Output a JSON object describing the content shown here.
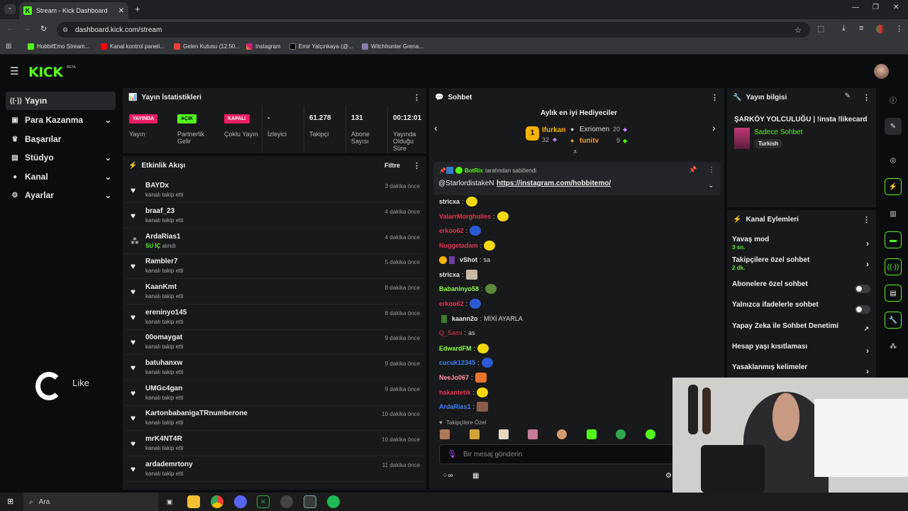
{
  "browser": {
    "tab_title": "Stream - Kick Dashboard",
    "url": "dashboard.kick.com/stream",
    "bookmarks": [
      "HobbitEmo Stream...",
      "Kanal kontrol paneli...",
      "Gelen Kutusu (12.50...",
      "Instagram",
      "Emir Yalçınkaya (@...",
      "Witchhunter Grena..."
    ]
  },
  "app": {
    "logo": "KICK",
    "beta": "BETA"
  },
  "sidebar": {
    "items": [
      {
        "label": "Yayın",
        "icon": "broadcast-icon"
      },
      {
        "label": "Para Kazanma",
        "icon": "money-icon"
      },
      {
        "label": "Başarılar",
        "icon": "trophy-icon"
      },
      {
        "label": "Stüdyo",
        "icon": "studio-icon"
      },
      {
        "label": "Kanal",
        "icon": "user-icon"
      },
      {
        "label": "Ayarlar",
        "icon": "gear-icon"
      }
    ]
  },
  "overlay": {
    "like": "Like"
  },
  "stats": {
    "title": "Yayın İstatistikleri",
    "items": [
      {
        "badge": "YAYINDA",
        "label": "Yayın"
      },
      {
        "badge": "AÇIK",
        "label": "Partnerlik Gelir"
      },
      {
        "badge": "KAPALI",
        "label": "Çoklu Yayın"
      },
      {
        "value": "-",
        "label": "İzleyici"
      },
      {
        "value": "61.278",
        "label": "Takipçi"
      },
      {
        "value": "131",
        "label": "Abone Sayısı"
      },
      {
        "value": "00:12:01",
        "label": "Yayında Olduğu Süre"
      }
    ]
  },
  "activity": {
    "title": "Etkinlik Akışı",
    "filter": "Filtre",
    "items": [
      {
        "name": "BAYDx",
        "sub": "kanalı takip etti",
        "time": "3 dakika önce"
      },
      {
        "name": "braaf_23",
        "sub": "kanalı takip etti",
        "time": "4 dakika önce"
      },
      {
        "name": "ArdaRias1",
        "sub_hl": "SU İÇ",
        "sub": "alındı",
        "time": "4 dakika önce"
      },
      {
        "name": "Rambler7",
        "sub": "kanalı takip etti",
        "time": "5 dakika önce"
      },
      {
        "name": "KaanKmt",
        "sub": "kanalı takip etti",
        "time": "8 dakika önce"
      },
      {
        "name": "ereninyo145",
        "sub": "kanalı takip etti",
        "time": "8 dakika önce"
      },
      {
        "name": "00omaygat",
        "sub": "kanalı takip etti",
        "time": "9 dakika önce"
      },
      {
        "name": "batuhanxw",
        "sub": "kanalı takip etti",
        "time": "9 dakika önce"
      },
      {
        "name": "UMGc4gan",
        "sub": "kanalı takip etti",
        "time": "9 dakika önce"
      },
      {
        "name": "KartonbabanigaTRnumberone",
        "sub": "kanalı takip etti",
        "time": "10 dakika önce"
      },
      {
        "name": "mrK4NT4R",
        "sub": "kanalı takip etti",
        "time": "10 dakika önce"
      },
      {
        "name": "ardademrtony",
        "sub": "kanalı takip etti",
        "time": "11 dakika önce"
      }
    ]
  },
  "chat": {
    "title": "Sohbet",
    "gifters_title": "Aylık en iyi Hediyeciler",
    "gifters": [
      {
        "name": "Ifurkan",
        "count": "32"
      },
      {
        "name": "Exriomen",
        "count": "20"
      },
      {
        "name": "tunitv",
        "count": "9"
      }
    ],
    "pinned_by": "BotRix",
    "pinned_suffix": "tarafından sabitlendi",
    "pinned_user": "@StarlordistakeN",
    "pinned_link": "https://instagram.com/hobbitemo/",
    "messages": [
      {
        "user": "stricxa",
        "color": "#e8e8e8",
        "text": ""
      },
      {
        "user": "ValarrMorghulles",
        "color": "#e0364f",
        "text": ""
      },
      {
        "user": "erkoo62",
        "color": "#e0364f",
        "text": ""
      },
      {
        "user": "Nuggetadam",
        "color": "#e0364f",
        "text": ""
      },
      {
        "user": "vShot",
        "color": "#e8e8e8",
        "text": "sa"
      },
      {
        "user": "stricxa",
        "color": "#e8e8e8",
        "text": ""
      },
      {
        "user": "Babaninyo58",
        "color": "#8bff4e",
        "text": ""
      },
      {
        "user": "erkoo62",
        "color": "#e0364f",
        "text": ""
      },
      {
        "user": "kaann2o",
        "color": "#e8e8e8",
        "text": "MİXİ AYARLA"
      },
      {
        "user": "Q_Sami",
        "color": "#e0364f",
        "text": "as"
      },
      {
        "user": "EdwardFM",
        "color": "#8bff4e",
        "text": ""
      },
      {
        "user": "cucuk12345",
        "color": "#3b82f6",
        "text": ""
      },
      {
        "user": "NeeJo067",
        "color": "#ff8fa3",
        "text": ""
      },
      {
        "user": "hakantetik",
        "color": "#e0364f",
        "text": ""
      },
      {
        "user": "ArdaRias1",
        "color": "#3b82f6",
        "text": ""
      }
    ],
    "follower_only": "Takipçilere Özel",
    "input_placeholder": "Bir mesaj gönderin"
  },
  "info": {
    "title": "Yayın bilgisi",
    "stream_title": "ŞARKÖY YOLCULUĞU | !insta !likecard",
    "category": "Sadece Sohbet",
    "tag": "Turkish"
  },
  "actions": {
    "title": "Kanal Eylemleri",
    "rows": [
      {
        "label": "Yavaş mod",
        "sub": "3 sn.",
        "control": "arrow"
      },
      {
        "label": "Takipçilere özel sohbet",
        "sub": "2 dk.",
        "control": "arrow"
      },
      {
        "label": "Abonelere özel sohbet",
        "control": "toggle"
      },
      {
        "label": "Yalnızca ifadelerle sohbet",
        "control": "toggle"
      },
      {
        "label": "Yapay Zeka ile Sohbet Denetimi",
        "control": "external"
      },
      {
        "label": "Hesap yaşı kısıtlaması",
        "control": "arrow"
      },
      {
        "label": "Yasaklanmış kelimeler",
        "control": "arrow"
      }
    ]
  },
  "taskbar": {
    "search": "Ara"
  },
  "colors": {
    "accent": "#53fc18",
    "live_red": "#e91e63",
    "bg": "#0b0c0d",
    "panel": "#18191b"
  }
}
